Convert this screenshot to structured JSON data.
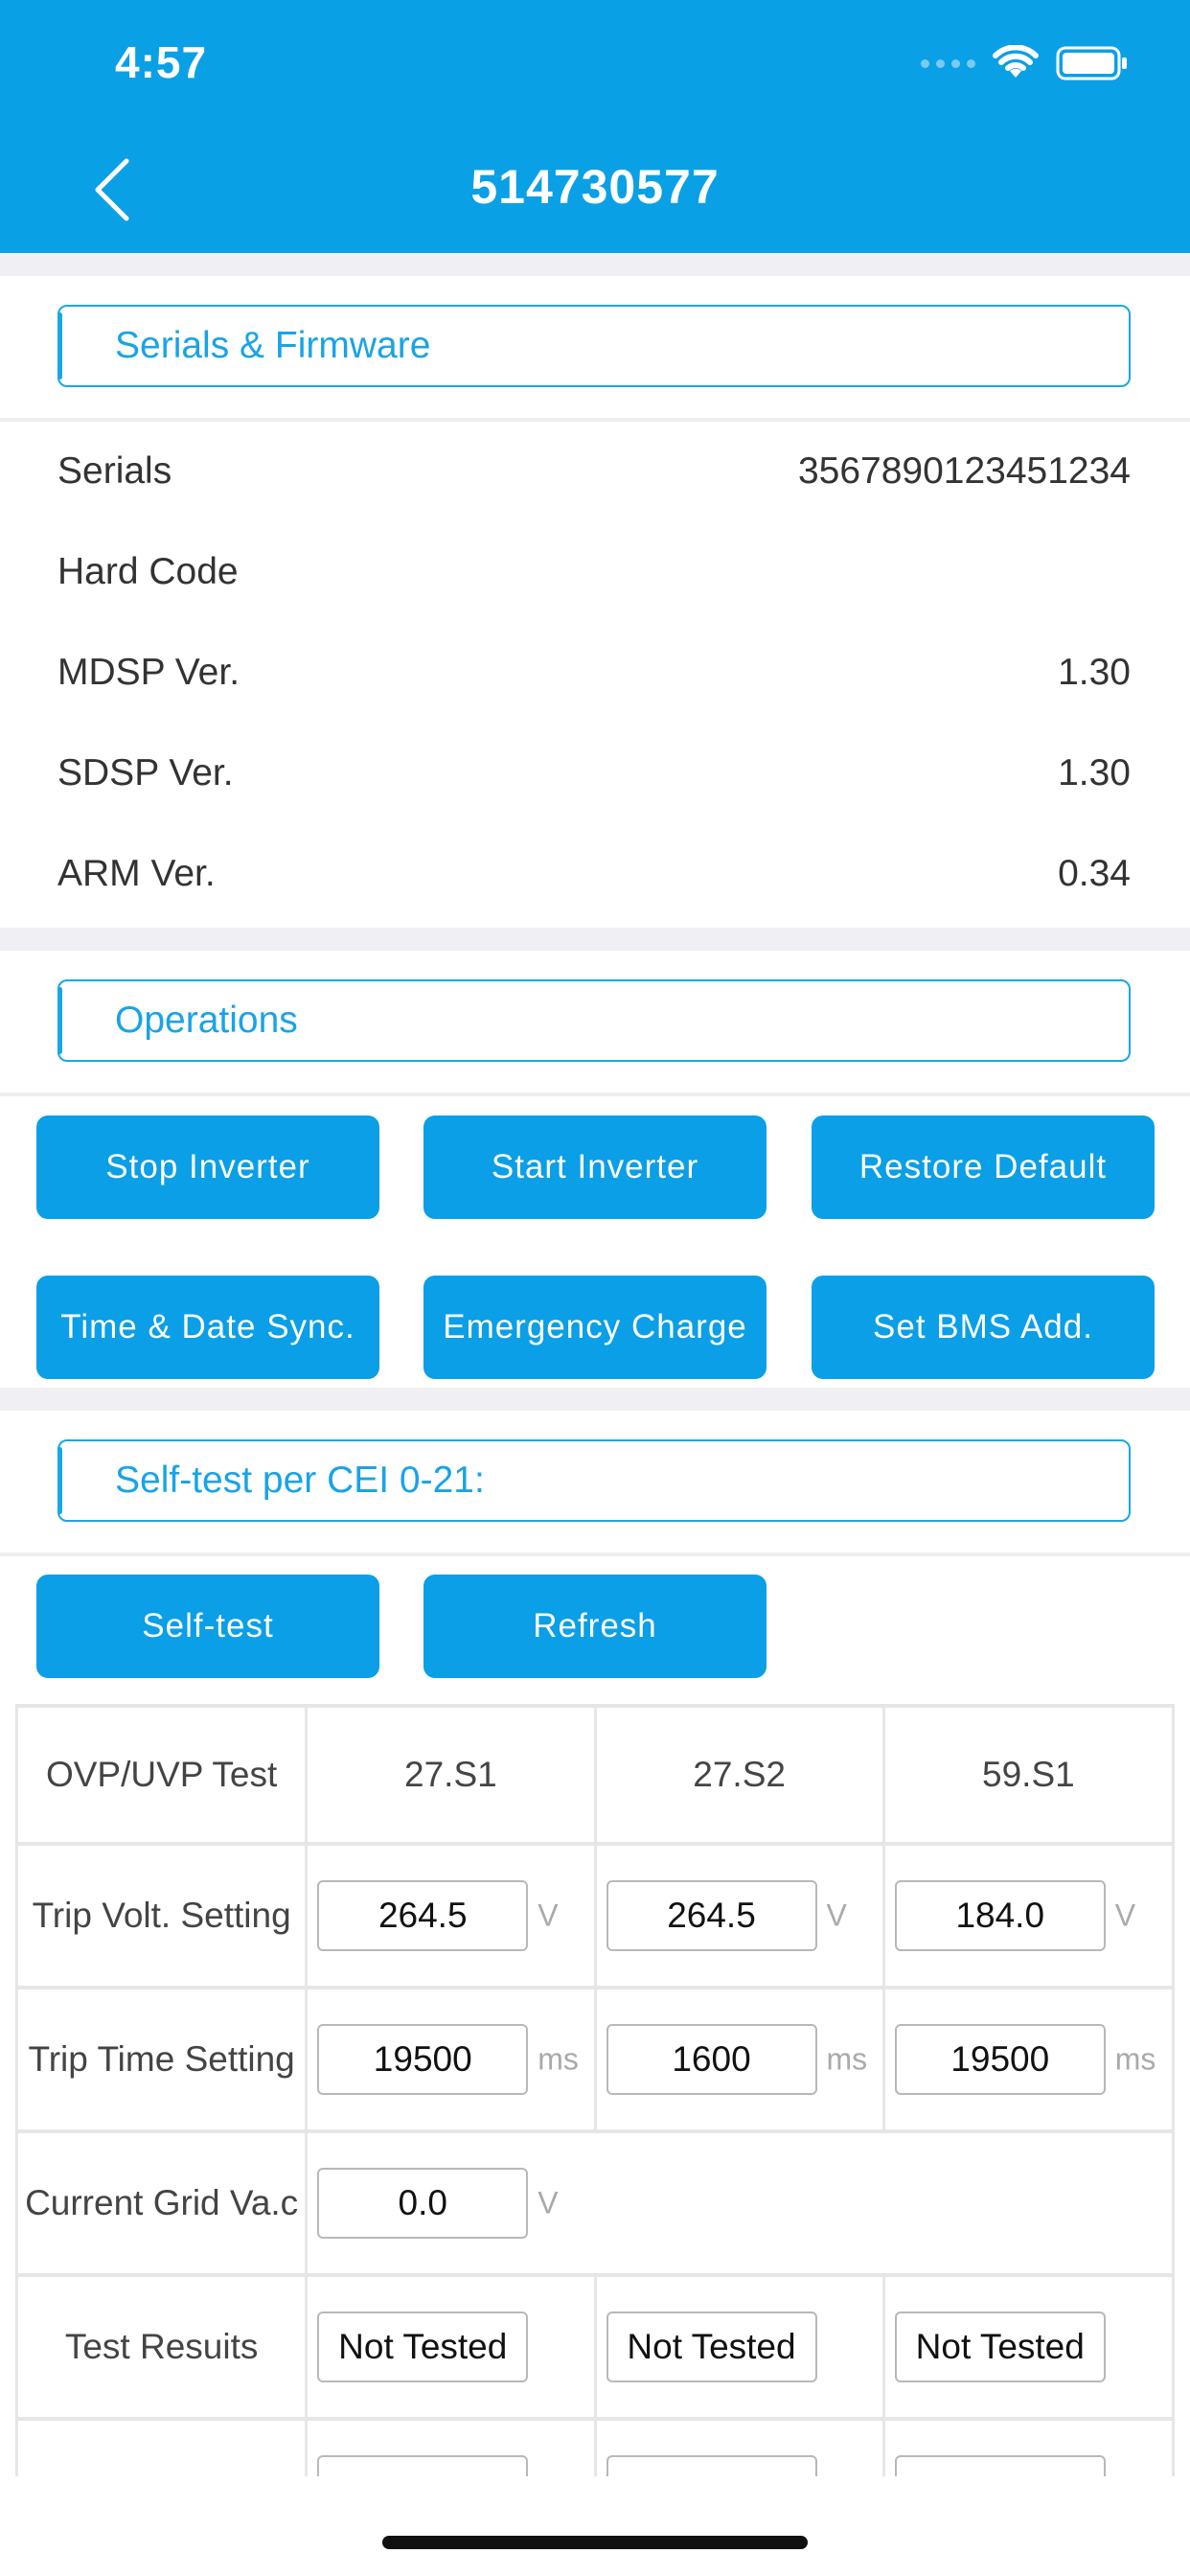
{
  "status_bar": {
    "time": "4:57"
  },
  "nav": {
    "title": "514730577"
  },
  "serials_firmware": {
    "title": "Serials & Firmware",
    "rows": [
      {
        "label": "Serials",
        "value": "3567890123451234"
      },
      {
        "label": "Hard Code",
        "value": ""
      },
      {
        "label": "MDSP Ver.",
        "value": "1.30"
      },
      {
        "label": "SDSP Ver.",
        "value": "1.30"
      },
      {
        "label": "ARM Ver.",
        "value": "0.34"
      }
    ]
  },
  "operations": {
    "title": "Operations",
    "buttons": {
      "stop_inverter": "Stop Inverter",
      "start_inverter": "Start Inverter",
      "restore_default": "Restore Default",
      "time_date_sync": "Time & Date Sync.",
      "emergency_charge": "Emergency Charge",
      "set_bms_add": "Set BMS Add."
    }
  },
  "self_test": {
    "title": "Self-test per CEI 0-21:",
    "buttons": {
      "self_test": "Self-test",
      "refresh": "Refresh"
    },
    "table": {
      "headers": [
        "OVP/UVP Test",
        "27.S1",
        "27.S2",
        "59.S1"
      ],
      "trip_volt": {
        "label": "Trip Volt. Setting",
        "values": [
          "264.5",
          "264.5",
          "184.0"
        ],
        "unit": "V"
      },
      "trip_time": {
        "label": "Trip Time Setting",
        "values": [
          "19500",
          "1600",
          "19500"
        ],
        "unit": "ms"
      },
      "grid_va": {
        "label": "Current Grid Va.c",
        "value": "0.0",
        "unit": "V"
      },
      "results": {
        "label": "Test Resuits",
        "values": [
          "Not Tested",
          "Not Tested",
          "Not Tested"
        ]
      }
    }
  },
  "colors": {
    "header": "#0aa0e6",
    "accent": "#19a7e6",
    "button": "#0a9fe6",
    "background_gap": "#efeff4"
  },
  "icons": {
    "back": "chevron-left-icon",
    "wifi": "wifi-icon",
    "battery": "battery-icon",
    "signal": "signal-icon"
  }
}
